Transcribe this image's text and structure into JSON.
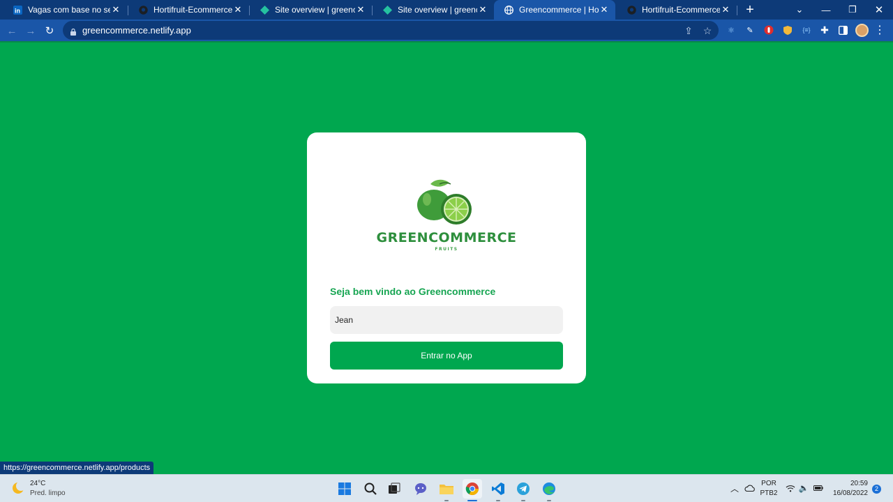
{
  "browser": {
    "tabs": [
      {
        "title": "Vagas com base no seu perfil",
        "favicon": "linkedin-icon"
      },
      {
        "title": "Hortifruit-Ecommerce/readme",
        "favicon": "github-icon"
      },
      {
        "title": "Site overview | greencommerce",
        "favicon": "netlify-icon"
      },
      {
        "title": "Site overview | greencommerce",
        "favicon": "netlify-icon"
      },
      {
        "title": "Greencommerce | Hortifruit",
        "favicon": "globe-icon",
        "active": true
      },
      {
        "title": "Hortifruit-Ecommerce/public",
        "favicon": "github-icon"
      }
    ],
    "new_tab_label": "+",
    "url": "greencommerce.netlify.app",
    "status_url": "https://greencommerce.netlify.app/products"
  },
  "page": {
    "brand_name": "GREENCOMMERCE",
    "brand_sub": "FRUITS",
    "welcome": "Seja bem vindo ao Greencommerce",
    "name_value": "Jean",
    "enter_button": "Entrar no App"
  },
  "taskbar": {
    "temperature": "24°C",
    "condition": "Pred. limpo",
    "apps": [
      "windows-start-icon",
      "search-icon",
      "task-view-icon",
      "teams-chat-icon",
      "file-explorer-icon",
      "chrome-icon",
      "vscode-icon",
      "telegram-icon",
      "edge-icon"
    ],
    "lang_top": "POR",
    "lang_bottom": "PTB2",
    "time": "20:59",
    "date": "16/08/2022",
    "notifications": "2"
  },
  "colors": {
    "page_bg": "#00a74f",
    "chrome_dark": "#0d3a78",
    "chrome_light": "#1a56a8",
    "brand_green": "#2e8f3d",
    "button_green": "#00a74f"
  }
}
